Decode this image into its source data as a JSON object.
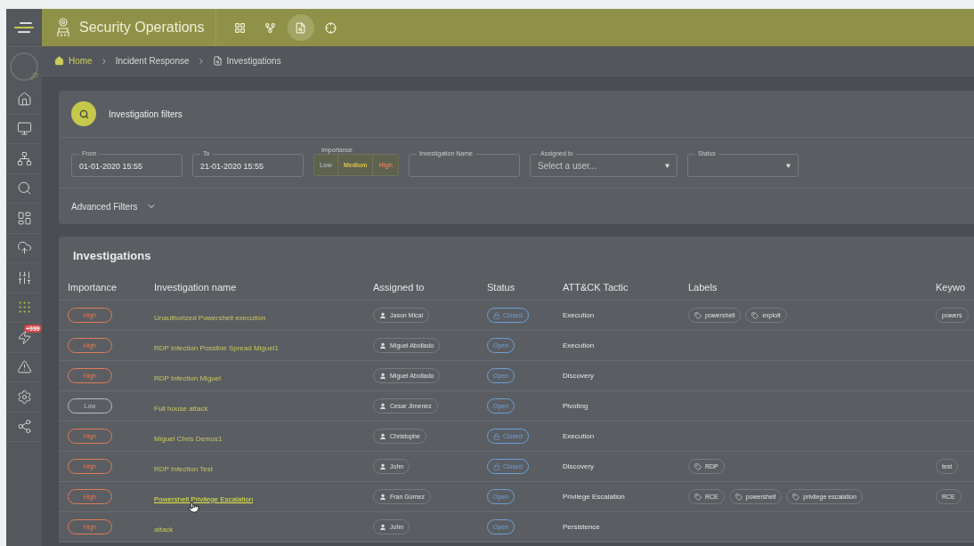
{
  "app": {
    "title": "Security Operations"
  },
  "top_nav": [
    {
      "kind": "dashboard",
      "selected": false
    },
    {
      "kind": "graph",
      "selected": false
    },
    {
      "kind": "investigations",
      "selected": true
    },
    {
      "kind": "target",
      "selected": false
    }
  ],
  "sidebar": {
    "items": [
      {
        "kind": "home"
      },
      {
        "kind": "monitor"
      },
      {
        "kind": "network"
      },
      {
        "kind": "search"
      },
      {
        "kind": "layout"
      },
      {
        "kind": "cloud"
      },
      {
        "kind": "sliders"
      },
      {
        "kind": "grid"
      },
      {
        "kind": "alerts",
        "badge": "+999"
      },
      {
        "kind": "warning"
      },
      {
        "kind": "settings"
      },
      {
        "kind": "share"
      }
    ]
  },
  "breadcrumb": [
    {
      "label": "Home",
      "kind": "home"
    },
    {
      "label": "Incident Response",
      "kind": "plain"
    },
    {
      "label": "Investigations",
      "kind": "page"
    }
  ],
  "filters": {
    "title": "Investigation filters",
    "from": {
      "label": "From",
      "value": "01-01-2020 15:55"
    },
    "to": {
      "label": "To",
      "value": "21-01-2020 15:55"
    },
    "importance": {
      "label": "Importance",
      "options": [
        {
          "label": "Low",
          "kind": "low",
          "selected": false
        },
        {
          "label": "Medium",
          "kind": "medium",
          "selected": true
        },
        {
          "label": "High",
          "kind": "high",
          "selected": true
        }
      ]
    },
    "investigation_name": {
      "label": "Investigation Name"
    },
    "assigned_to": {
      "label": "Assigned to",
      "placeholder": "Select a user..."
    },
    "status": {
      "label": "Status"
    },
    "advanced": {
      "label": "Advanced Filters",
      "expanded": false
    }
  },
  "investigations": {
    "title": "Investigations",
    "columns": [
      "Importance",
      "Investigation name",
      "Assigned to",
      "Status",
      "ATT&CK Tactic",
      "Labels",
      "Keywo"
    ],
    "rows": [
      {
        "importance": {
          "label": "High",
          "kind": "high"
        },
        "name": "Unauthorized Powershell execution",
        "hovered": false,
        "assigned": "Jason Mical",
        "status": {
          "label": "Closed",
          "kind": "closed"
        },
        "tactic": "Execution",
        "labels": [
          "powershell",
          "exploit"
        ],
        "keywords": [
          "powers"
        ]
      },
      {
        "importance": {
          "label": "High",
          "kind": "high"
        },
        "name": "RDP Infection Possible Spread Miguel1",
        "hovered": false,
        "assigned": "Miguel Abollado",
        "status": {
          "label": "Open",
          "kind": "open"
        },
        "tactic": "Execution",
        "labels": [],
        "keywords": []
      },
      {
        "importance": {
          "label": "High",
          "kind": "high"
        },
        "name": "RDP Infection Miguel",
        "hovered": false,
        "assigned": "Miguel Abollado",
        "status": {
          "label": "Open",
          "kind": "open"
        },
        "tactic": "Discovery",
        "labels": [],
        "keywords": []
      },
      {
        "importance": {
          "label": "Low",
          "kind": "low"
        },
        "name": "Full house attack",
        "hovered": false,
        "assigned": "Cesar Jimenez",
        "status": {
          "label": "Open",
          "kind": "open"
        },
        "tactic": "Pivoting",
        "labels": [],
        "keywords": []
      },
      {
        "importance": {
          "label": "High",
          "kind": "high"
        },
        "name": "Miguel Chris Demos1",
        "hovered": false,
        "assigned": "Christophe",
        "status": {
          "label": "Closed",
          "kind": "closed"
        },
        "tactic": "Execution",
        "labels": [],
        "keywords": []
      },
      {
        "importance": {
          "label": "High",
          "kind": "high"
        },
        "name": "RDP Infection Test",
        "hovered": false,
        "assigned": "John",
        "status": {
          "label": "Closed",
          "kind": "closed"
        },
        "tactic": "Discovery",
        "labels": [
          "RDP"
        ],
        "keywords": [
          "test"
        ]
      },
      {
        "importance": {
          "label": "High",
          "kind": "high"
        },
        "name": "Powershell Privilege Escalation",
        "hovered": true,
        "assigned": "Fran Gomez",
        "status": {
          "label": "Open",
          "kind": "open"
        },
        "tactic": "Privilege Escalation",
        "labels": [
          "RCE",
          "powershell",
          "privilege escalation"
        ],
        "keywords": [
          "RCE"
        ]
      },
      {
        "importance": {
          "label": "High",
          "kind": "high"
        },
        "name": "attack",
        "hovered": false,
        "assigned": "John",
        "status": {
          "label": "Open",
          "kind": "open"
        },
        "tactic": "Persistence",
        "labels": [],
        "keywords": []
      }
    ]
  }
}
